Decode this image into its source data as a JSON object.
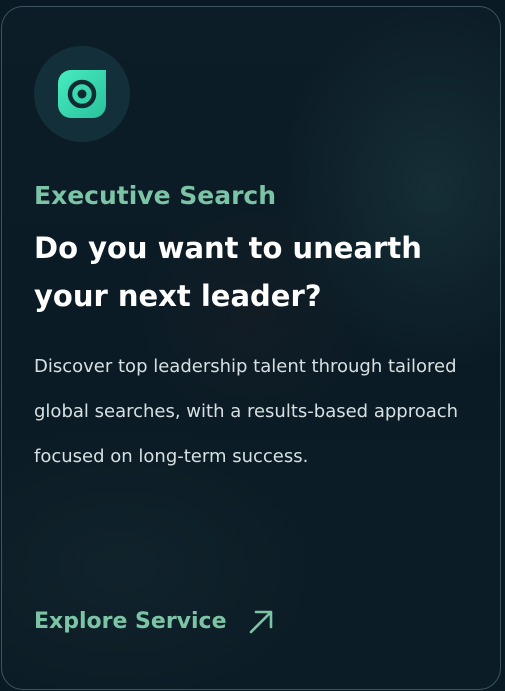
{
  "card": {
    "icon": "target-leaf-icon",
    "category": "Executive Search",
    "headline": "Do you want to unearth your next leader?",
    "description": "Discover top leadership talent through tailored global searches, with a results-based approach focused on long-term success.",
    "cta": {
      "label": "Explore Service",
      "icon": "arrow-up-right-icon"
    }
  },
  "colors": {
    "accent": "#7cc4a6",
    "icon_gradient_start": "#3fe6b8",
    "icon_gradient_end": "#2fc9a2",
    "background": "#0b1b25",
    "headline": "#ffffff",
    "body_text": "#d6e0e2"
  }
}
